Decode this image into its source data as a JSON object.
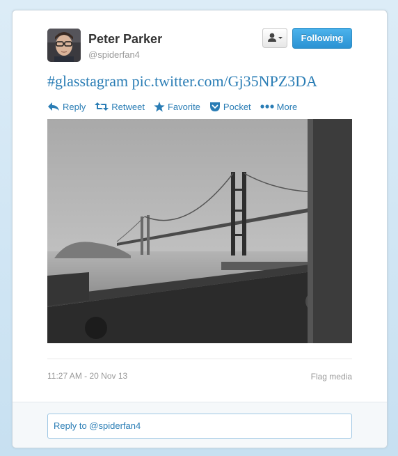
{
  "user": {
    "fullname": "Peter Parker",
    "username": "@spiderfan4"
  },
  "header": {
    "following_label": "Following",
    "user_menu_icon": "person-dropdown-icon"
  },
  "tweet": {
    "hashtag": "#glasstagram",
    "link": "pic.twitter.com/Gj35NPZ3DA"
  },
  "actions": [
    {
      "label": "Reply",
      "icon": "reply-icon"
    },
    {
      "label": "Retweet",
      "icon": "retweet-icon"
    },
    {
      "label": "Favorite",
      "icon": "star-icon"
    },
    {
      "label": "Pocket",
      "icon": "pocket-icon"
    },
    {
      "label": "More",
      "icon": "more-dots-icon"
    }
  ],
  "meta": {
    "timestamp": "11:27 AM - 20 Nov 13",
    "flag_label": "Flag media"
  },
  "reply": {
    "placeholder": "Reply to @spiderfan4"
  },
  "colors": {
    "link": "#2a7db5",
    "following_button": "#2a92d3",
    "background": "#c7e0f1"
  }
}
